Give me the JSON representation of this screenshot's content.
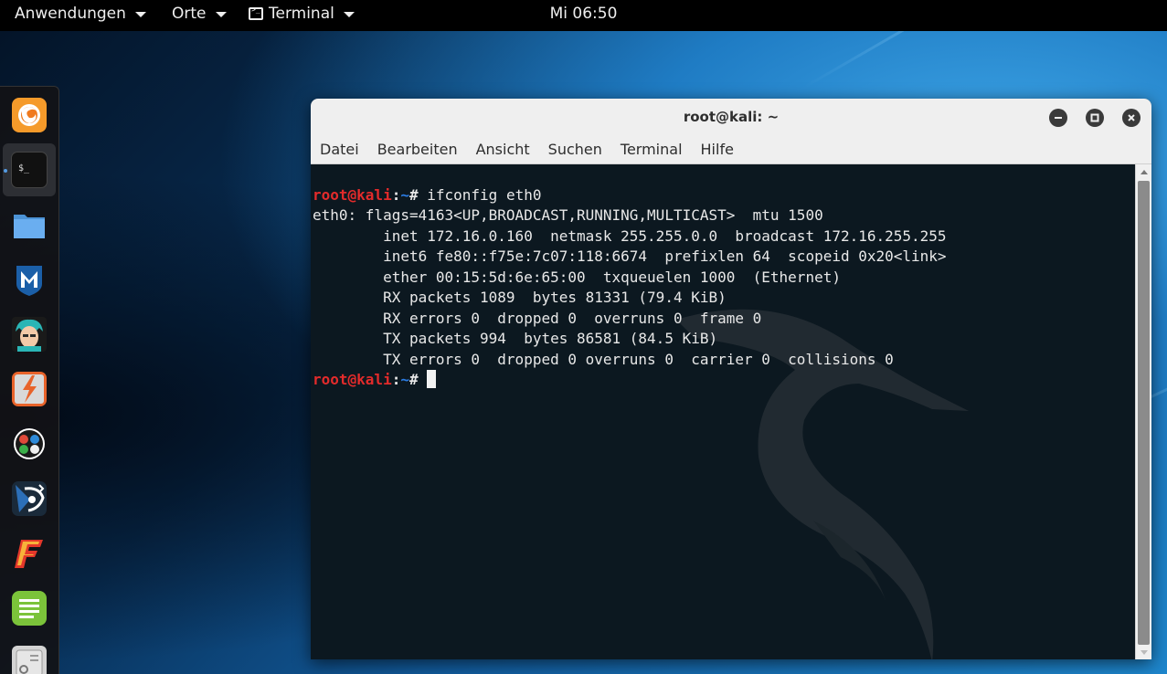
{
  "topbar": {
    "applications": "Anwendungen",
    "places": "Orte",
    "app_name": "Terminal",
    "clock": "Mi 06:50"
  },
  "dock": {
    "items": [
      {
        "name": "firefox-icon",
        "color": "#f07a1e"
      },
      {
        "name": "terminal-icon",
        "color": "#1c1c1c"
      },
      {
        "name": "files-icon",
        "color": "#3f8ed8"
      },
      {
        "name": "metasploit-icon",
        "color": "#1b5fa8"
      },
      {
        "name": "armitage-icon",
        "color": "#2aa5a5"
      },
      {
        "name": "burpsuite-icon",
        "color": "#e8632a"
      },
      {
        "name": "maltego-icon",
        "color": "#ffffff"
      },
      {
        "name": "beef-icon",
        "color": "#2c6fb8"
      },
      {
        "name": "faraday-icon",
        "color": "#e3372a"
      },
      {
        "name": "leafpad-icon",
        "color": "#7bc33a"
      },
      {
        "name": "cherrytree-icon",
        "color": "#cccccc"
      }
    ]
  },
  "window": {
    "title": "root@kali: ~",
    "menu": [
      "Datei",
      "Bearbeiten",
      "Ansicht",
      "Suchen",
      "Terminal",
      "Hilfe"
    ]
  },
  "terminal": {
    "prompt_user": "root@kali",
    "prompt_sep": ":",
    "prompt_path": "~",
    "prompt_suffix": "# ",
    "command": "ifconfig eth0",
    "output": [
      "eth0: flags=4163<UP,BROADCAST,RUNNING,MULTICAST>  mtu 1500",
      "        inet 172.16.0.160  netmask 255.255.0.0  broadcast 172.16.255.255",
      "        inet6 fe80::f75e:7c07:118:6674  prefixlen 64  scopeid 0x20<link>",
      "        ether 00:15:5d:6e:65:00  txqueuelen 1000  (Ethernet)",
      "        RX packets 1089  bytes 81331 (79.4 KiB)",
      "        RX errors 0  dropped 0  overruns 0  frame 0",
      "        TX packets 994  bytes 86581 (84.5 KiB)",
      "        TX errors 0  dropped 0 overruns 0  carrier 0  collisions 0",
      ""
    ]
  }
}
